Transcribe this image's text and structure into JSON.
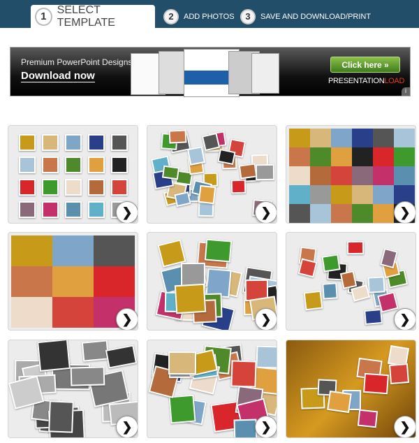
{
  "steps": [
    {
      "num": "1",
      "label": "SELECT TEMPLATE",
      "active": true
    },
    {
      "num": "2",
      "label": "ADD PHOTOS"
    },
    {
      "num": "3",
      "label": "SAVE AND DOWNLOAD/PRINT"
    }
  ],
  "banner": {
    "line1": "Premium PowerPoint Designs",
    "line2": "Download now",
    "cta": "Click here »",
    "brand_a": "PRESENTATION",
    "brand_b": "LOAD",
    "info_icon": "info-icon"
  },
  "templates": [
    {
      "style": "grid"
    },
    {
      "style": "scatter"
    },
    {
      "style": "mosaic"
    },
    {
      "style": "large-mosaic"
    },
    {
      "style": "overlap"
    },
    {
      "style": "scatter-sparse"
    },
    {
      "style": "grayscale-overlap"
    },
    {
      "style": "tilted-overlap"
    },
    {
      "style": "autumn-background"
    }
  ],
  "next_icon": "chevron-right-icon"
}
